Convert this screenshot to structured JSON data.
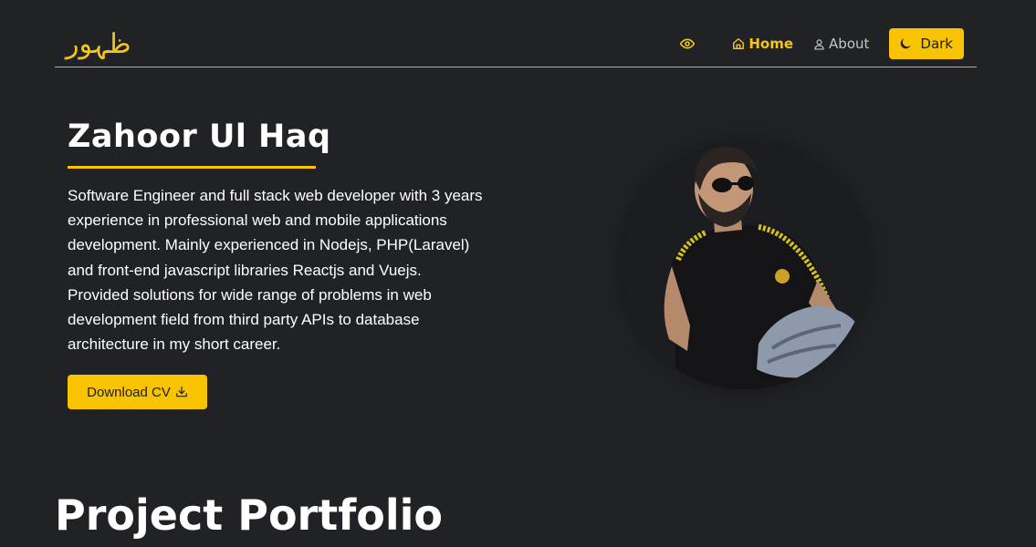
{
  "header": {
    "logo_text": "ظہور",
    "nav": {
      "home": "Home",
      "about": "About",
      "dark": "Dark"
    }
  },
  "hero": {
    "name": "Zahoor Ul Haq",
    "bio_lines": [
      "Software Engineer and full stack web developer with 3 years",
      "experience in professional web and mobile applications",
      "development. Mainly experienced in Nodejs, PHP(Laravel)",
      "and front-end javascript libraries Reactjs and Vuejs.",
      "Provided solutions for wide range of problems in web",
      "development field from third party APIs to database",
      "architecture in my short career."
    ],
    "cta_label": "Download CV"
  },
  "portfolio": {
    "title": "Project Portfolio"
  },
  "icons": {
    "eye": "eye-icon",
    "home": "home-icon",
    "user": "user-icon",
    "moon": "moon-icon",
    "download": "download-icon"
  },
  "colors": {
    "background": "#212226",
    "accent": "#f8c300",
    "text": "#ffffff",
    "muted": "#c6c6c9"
  }
}
